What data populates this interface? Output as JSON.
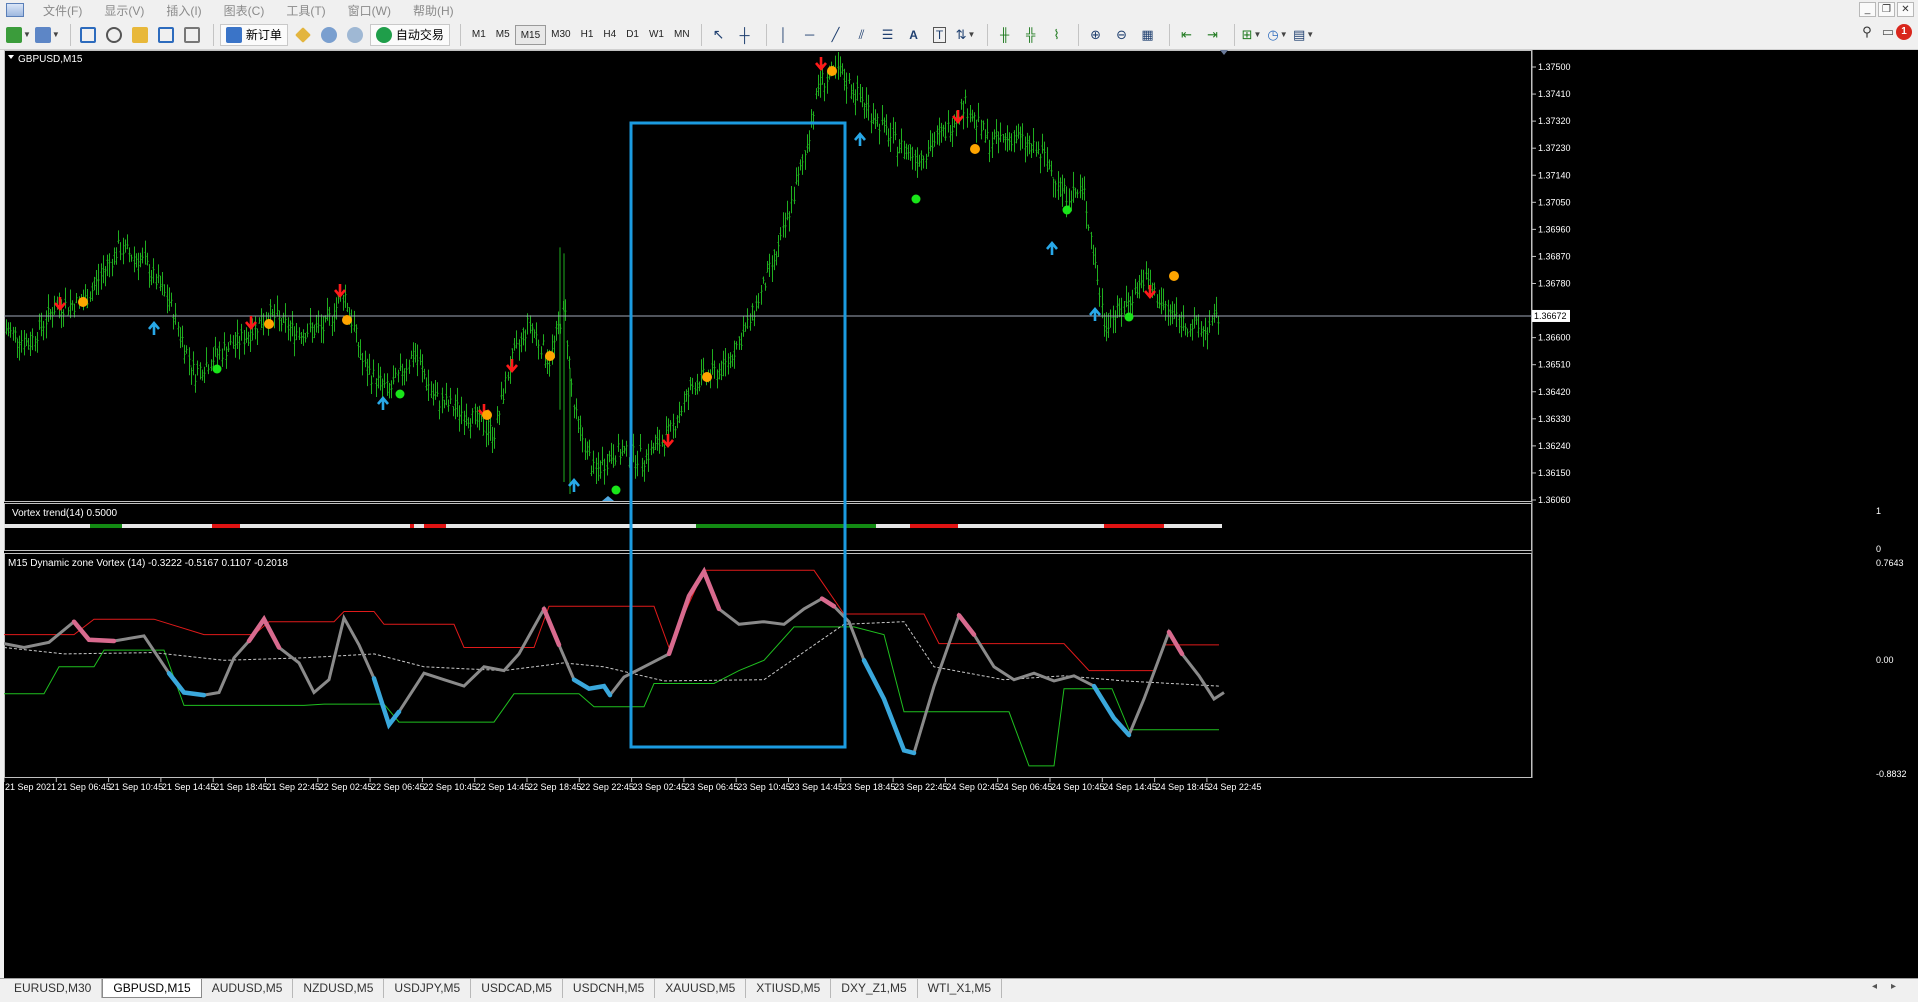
{
  "menubar": {
    "items": [
      "文件(F)",
      "显示(V)",
      "插入(I)",
      "图表(C)",
      "工具(T)",
      "窗口(W)",
      "帮助(H)"
    ],
    "window_buttons": [
      "_",
      "❐",
      "✕"
    ]
  },
  "toolbar": {
    "new_order_label": "新订单",
    "auto_trading_label": "自动交易",
    "timeframes": [
      "M1",
      "M5",
      "M15",
      "M30",
      "H1",
      "H4",
      "D1",
      "W1",
      "MN"
    ],
    "active_timeframe": "M15",
    "notification_count": "1"
  },
  "chart": {
    "title": "GBPUSD,M15",
    "current_price_label": "1.36672",
    "price_ticks": [
      "1.37500",
      "1.37410",
      "1.37320",
      "1.37230",
      "1.37140",
      "1.37050",
      "1.36960",
      "1.36870",
      "1.36780",
      "1.36600",
      "1.36510",
      "1.36420",
      "1.36330",
      "1.36240",
      "1.36150",
      "1.36060"
    ],
    "time_ticks": [
      "21 Sep 2021",
      "21 Sep 06:45",
      "21 Sep 10:45",
      "21 Sep 14:45",
      "21 Sep 18:45",
      "21 Sep 22:45",
      "22 Sep 02:45",
      "22 Sep 06:45",
      "22 Sep 10:45",
      "22 Sep 14:45",
      "22 Sep 18:45",
      "22 Sep 22:45",
      "23 Sep 02:45",
      "23 Sep 06:45",
      "23 Sep 10:45",
      "23 Sep 14:45",
      "23 Sep 18:45",
      "23 Sep 22:45",
      "24 Sep 02:45",
      "24 Sep 06:45",
      "24 Sep 10:45",
      "24 Sep 14:45",
      "24 Sep 18:45",
      "24 Sep 22:45"
    ],
    "colors": {
      "background": "#000000",
      "bars": "#1fae1f",
      "highlight_box": "#1b9be0",
      "sell_arrow": "#ff1a1a",
      "buy_arrow": "#28a8e8",
      "orange_dot": "#ffa500",
      "green_dot": "#19e619"
    }
  },
  "indicator1": {
    "label": "Vortex trend(14) 0.5000",
    "scale_top": "1",
    "scale_bottom": "0"
  },
  "indicator2": {
    "label": "M15 Dynamic zone Vortex (14) -0.3222 -0.5167 0.1107 -0.2018",
    "scale_top": "0.7643",
    "scale_mid": "0.00",
    "scale_bottom": "-0.8832"
  },
  "tabs": [
    "EURUSD,M30",
    "GBPUSD,M15",
    "AUDUSD,M5",
    "NZDUSD,M5",
    "USDJPY,M5",
    "USDCAD,M5",
    "USDCNH,M5",
    "XAUUSD,M5",
    "XTIUSD,M5",
    "DXY_Z1,M5",
    "WTI_X1,M5"
  ],
  "active_tab": "GBPUSD,M15"
}
